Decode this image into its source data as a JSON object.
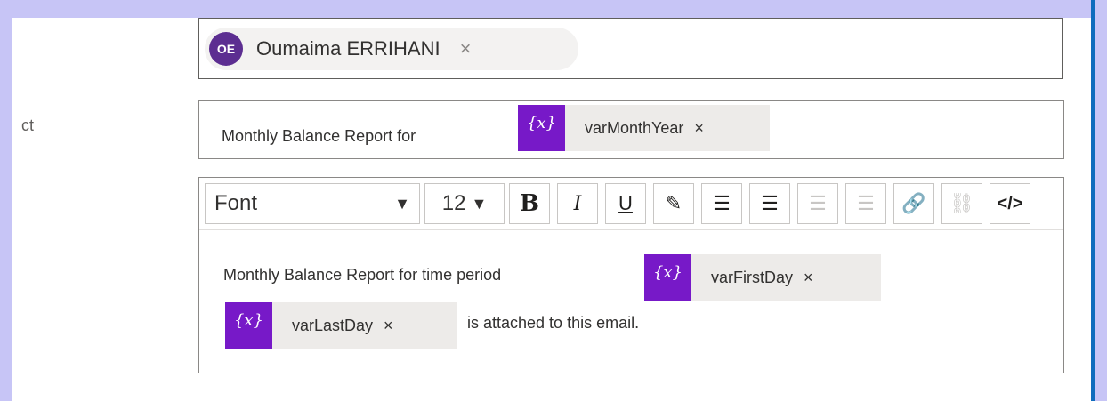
{
  "labels": {
    "subject_label_fragment": "ct"
  },
  "to": {
    "persona": {
      "initials": "OE",
      "name": "Oumaima ERRIHANI",
      "remove_glyph": "×"
    }
  },
  "subject": {
    "prefix_text": "Monthly Balance Report for",
    "token": {
      "icon_text": "{x}",
      "name": "varMonthYear",
      "remove_glyph": "×"
    }
  },
  "editor": {
    "toolbar": {
      "font_label": "Font",
      "font_arrow": "▼",
      "size_value": "12",
      "size_arrow": "▼",
      "buttons": [
        {
          "name": "bold",
          "glyph": "B",
          "enabled": true
        },
        {
          "name": "italic",
          "glyph": "I",
          "enabled": true
        },
        {
          "name": "underline",
          "glyph": "U",
          "enabled": true
        },
        {
          "name": "highlight",
          "glyph": "✎",
          "enabled": true
        },
        {
          "name": "bullets",
          "glyph": "☰",
          "enabled": true
        },
        {
          "name": "numbering",
          "glyph": "☰",
          "enabled": true
        },
        {
          "name": "indent",
          "glyph": "☰",
          "enabled": false
        },
        {
          "name": "outdent",
          "glyph": "☰",
          "enabled": false
        },
        {
          "name": "link",
          "glyph": "🔗",
          "enabled": true
        },
        {
          "name": "unlink",
          "glyph": "⛓",
          "enabled": false
        },
        {
          "name": "code",
          "glyph": "</>",
          "enabled": true
        }
      ]
    },
    "body": {
      "line1_text": "Monthly Balance Report for time period",
      "token_first": {
        "icon_text": "{x}",
        "name": "varFirstDay",
        "remove_glyph": "×"
      },
      "token_last": {
        "icon_text": "{x}",
        "name": "varLastDay",
        "remove_glyph": "×"
      },
      "line2_text": "is attached to this email."
    }
  }
}
